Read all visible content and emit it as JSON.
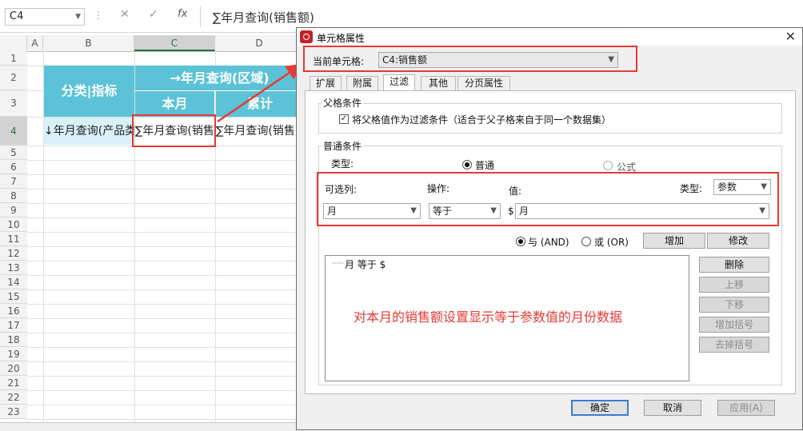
{
  "formula_bar": {
    "cell_ref": "C4",
    "cancel": "✕",
    "enter": "✓",
    "fx": "fx",
    "formula": "∑年月查询(销售额)"
  },
  "sheet": {
    "columns": [
      "A",
      "B",
      "C",
      "D"
    ],
    "rows": [
      "1",
      "2",
      "3",
      "4",
      "5",
      "6",
      "7",
      "8",
      "9",
      "10",
      "11",
      "12",
      "13",
      "14",
      "15",
      "16",
      "17",
      "18",
      "19",
      "20",
      "21",
      "22",
      "23"
    ],
    "cells": {
      "b2": "分类|指标",
      "c2": "→年月查询(区域)",
      "c3": "本月",
      "d3": "累计",
      "b4": "↓年月查询(产品类",
      "c4": "∑年月查询(销售",
      "d4": "∑年月查询(销售"
    }
  },
  "dialog": {
    "title": "单元格属性",
    "current_cell_label": "当前单元格:",
    "current_cell_value": "C4:销售额",
    "tabs": [
      "扩展",
      "附属",
      "过滤",
      "其他",
      "分页属性"
    ],
    "active_tab": "过滤",
    "parent_condition": {
      "title": "父格条件",
      "checkbox_label": "将父格值作为过滤条件（适合于父子格来自于同一个数据集）",
      "checked": true
    },
    "normal_condition": {
      "title": "普通条件",
      "type_label": "类型:",
      "radio_normal": "普通",
      "radio_formula": "公式",
      "column_label": "可选列:",
      "op_label": "操作:",
      "value_label": "值:",
      "value_type_label": "类型:",
      "value_type": "参数",
      "column_value": "月",
      "op_value": "等于",
      "value_prefix": "$",
      "value_value": "月",
      "and_label": "与 (AND)",
      "or_label": "或 (OR)",
      "add_button": "增加",
      "modify_button": "修改",
      "conditions": [
        "月 等于 $"
      ],
      "side_buttons": [
        "删除",
        "上移",
        "下移",
        "增加括号",
        "去掉括号"
      ]
    },
    "footer": {
      "ok": "确定",
      "cancel": "取消",
      "apply": "应用(A)"
    }
  },
  "annotation": "对本月的销售额设置显示等于参数值的月份数据",
  "colors": {
    "accent_red": "#e53935",
    "header_teal": "#5bc2d7",
    "excel_green": "#217346"
  }
}
